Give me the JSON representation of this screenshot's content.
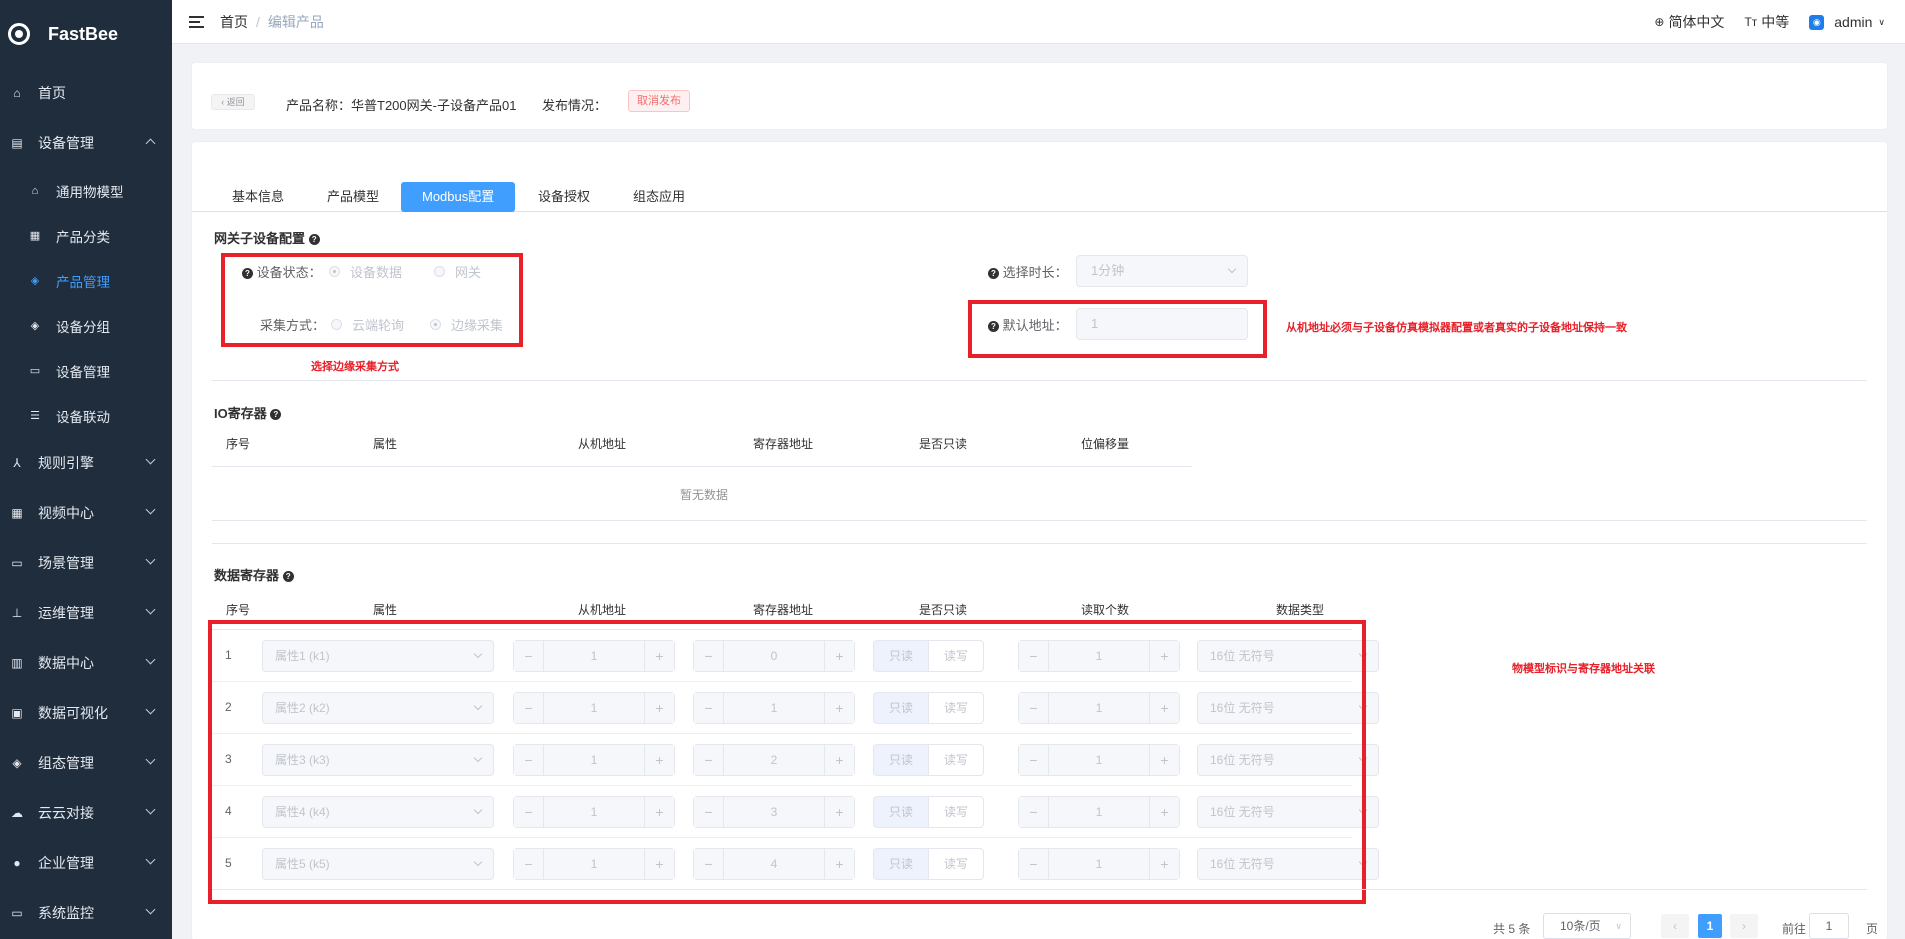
{
  "sidebar": {
    "logo": "FastBee",
    "items": [
      {
        "label": "首页",
        "icon": "home-icon"
      },
      {
        "label": "设备管理",
        "icon": "device-icon",
        "expanded": true
      },
      {
        "label": "通用物模型",
        "icon": "model-icon"
      },
      {
        "label": "产品分类",
        "icon": "category-icon"
      },
      {
        "label": "产品管理",
        "icon": "product-icon",
        "active": true
      },
      {
        "label": "设备分组",
        "icon": "group-icon"
      },
      {
        "label": "设备管理",
        "icon": "device-manage-icon"
      },
      {
        "label": "设备联动",
        "icon": "linkage-icon"
      },
      {
        "label": "规则引擎",
        "icon": "rule-icon"
      },
      {
        "label": "视频中心",
        "icon": "video-icon"
      },
      {
        "label": "场景管理",
        "icon": "scene-icon"
      },
      {
        "label": "运维管理",
        "icon": "ops-icon"
      },
      {
        "label": "数据中心",
        "icon": "data-icon"
      },
      {
        "label": "数据可视化",
        "icon": "visual-icon"
      },
      {
        "label": "组态管理",
        "icon": "config-icon"
      },
      {
        "label": "云云对接",
        "icon": "cloud-icon"
      },
      {
        "label": "企业管理",
        "icon": "enterprise-icon"
      },
      {
        "label": "系统监控",
        "icon": "monitor-icon"
      }
    ]
  },
  "header": {
    "breadcrumb_home": "首页",
    "breadcrumb_current": "编辑产品",
    "lang": "简体中文",
    "size": "中等",
    "user": "admin"
  },
  "product": {
    "back": "返回",
    "name_label": "产品名称：",
    "name": "华普T200网关-子设备产品01",
    "publish_label": "发布情况：",
    "publish_tag": "取消发布"
  },
  "tabs": [
    "基本信息",
    "产品模型",
    "Modbus配置",
    "设备授权",
    "组态应用"
  ],
  "gateway": {
    "title": "网关子设备配置",
    "status_label": "设备状态：",
    "status_opt1": "设备数据",
    "status_opt2": "网关",
    "collect_label": "采集方式：",
    "collect_opt1": "云端轮询",
    "collect_opt2": "边缘采集",
    "duration_label": "选择时长：",
    "duration_value": "1分钟",
    "addr_label": "默认地址：",
    "addr_value": "1",
    "note_collect": "选择边缘采集方式",
    "note_addr": "从机地址必须与子设备仿真模拟器配置或者真实的子设备地址保持一致"
  },
  "io": {
    "title": "IO寄存器",
    "headers": [
      "序号",
      "属性",
      "从机地址",
      "寄存器地址",
      "是否只读",
      "位偏移量"
    ],
    "empty": "暂无数据"
  },
  "data_reg": {
    "title": "数据寄存器",
    "headers": [
      "序号",
      "属性",
      "从机地址",
      "寄存器地址",
      "是否只读",
      "读取个数",
      "数据类型"
    ],
    "note": "物模型标识与寄存器地址关联",
    "readonly": "只读",
    "readwrite": "读写",
    "rows": [
      {
        "idx": "1",
        "attr": "属性1 (k1)",
        "slave": "1",
        "reg": "0",
        "count": "1",
        "type": "16位 无符号"
      },
      {
        "idx": "2",
        "attr": "属性2 (k2)",
        "slave": "1",
        "reg": "1",
        "count": "1",
        "type": "16位 无符号"
      },
      {
        "idx": "3",
        "attr": "属性3 (k3)",
        "slave": "1",
        "reg": "2",
        "count": "1",
        "type": "16位 无符号"
      },
      {
        "idx": "4",
        "attr": "属性4 (k4)",
        "slave": "1",
        "reg": "3",
        "count": "1",
        "type": "16位 无符号"
      },
      {
        "idx": "5",
        "attr": "属性5 (k5)",
        "slave": "1",
        "reg": "4",
        "count": "1",
        "type": "16位 无符号"
      }
    ]
  },
  "pager": {
    "total": "共 5 条",
    "size": "10条/页",
    "page": "1",
    "goto": "前往",
    "goto_value": "1",
    "page_suffix": "页"
  }
}
